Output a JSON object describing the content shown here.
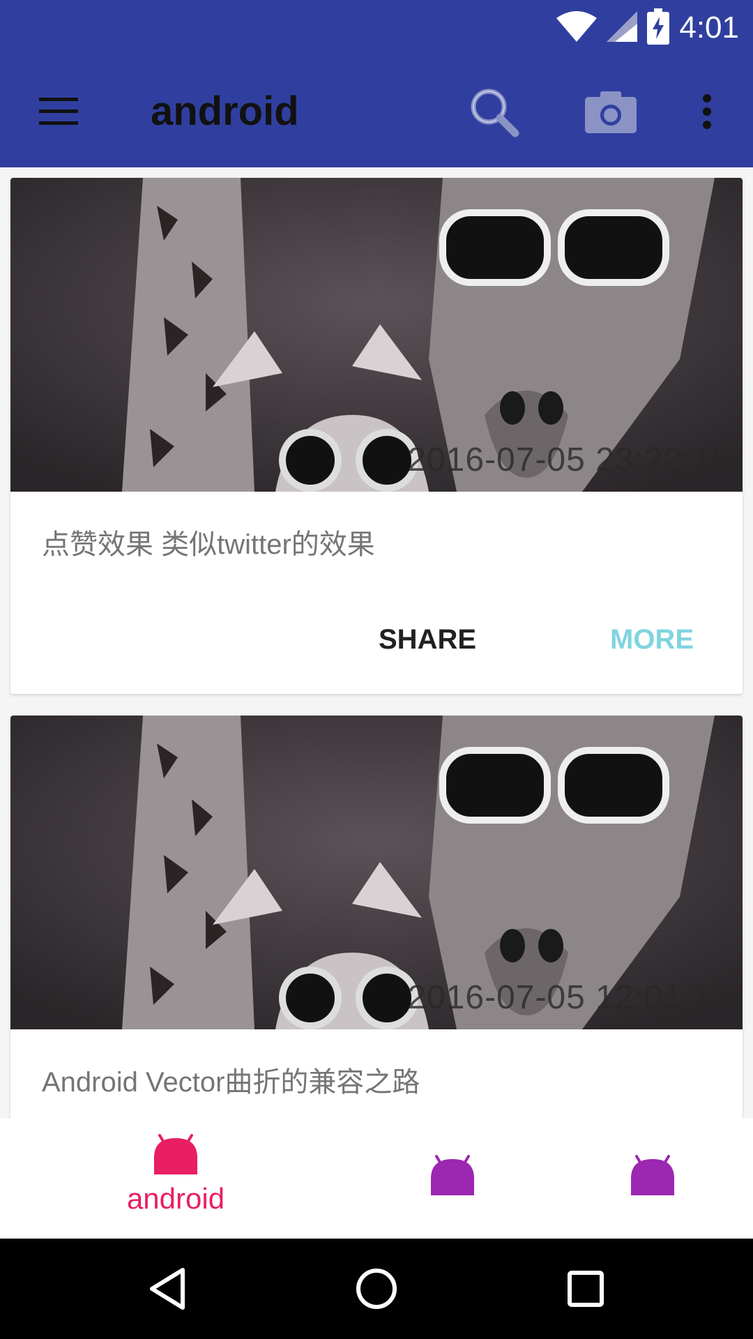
{
  "status_bar": {
    "time": "4:01"
  },
  "app_bar": {
    "title": "android",
    "icons": [
      "menu-icon",
      "search-icon",
      "camera-icon",
      "more-vert-icon"
    ]
  },
  "cards": [
    {
      "timestamp": "2016-07-05 23:22:15",
      "title": "点赞效果 类似twitter的效果",
      "share_label": "SHARE",
      "more_label": "MORE"
    },
    {
      "timestamp": "2016-07-05 12:01:15",
      "title": "Android Vector曲折的兼容之路"
    }
  ],
  "bottom_nav": {
    "items": [
      {
        "label": "android",
        "icon": "android-icon",
        "active": true,
        "color": "#e91e63"
      },
      {
        "label": "",
        "icon": "android-icon",
        "active": false,
        "color": "#9c27b0"
      },
      {
        "label": "",
        "icon": "android-icon",
        "active": false,
        "color": "#9c27b0"
      }
    ]
  },
  "colors": {
    "primary": "#303f9f",
    "accent": "#e91e63",
    "more_button": "#80d4e0"
  }
}
